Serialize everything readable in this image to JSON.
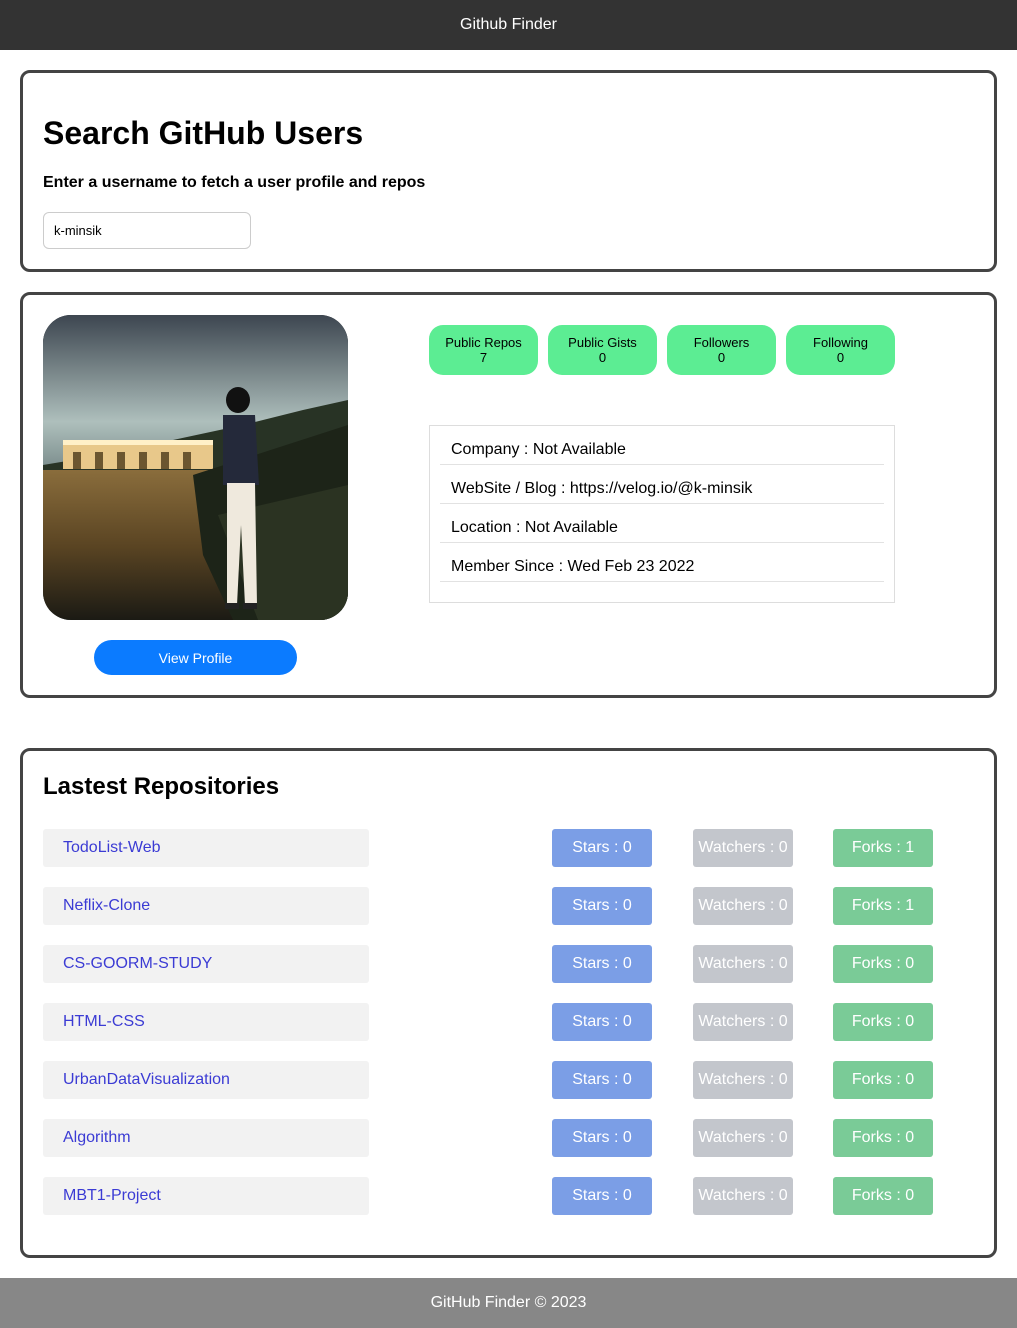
{
  "navbar": {
    "title": "Github Finder"
  },
  "search": {
    "title": "Search GitHub Users",
    "subtitle": "Enter a username to fetch a user profile and repos",
    "value": "k-minsik"
  },
  "profile": {
    "view_profile_label": "View Profile",
    "stats": [
      {
        "label": "Public Repos",
        "value": "7"
      },
      {
        "label": "Public Gists",
        "value": "0"
      },
      {
        "label": "Followers",
        "value": "0"
      },
      {
        "label": "Following",
        "value": "0"
      }
    ],
    "info": [
      "Company : Not Available",
      "WebSite / Blog : https://velog.io/@k-minsik",
      "Location : Not Available",
      "Member Since : Wed Feb 23 2022"
    ]
  },
  "repos": {
    "title": "Lastest Repositories",
    "items": [
      {
        "name": "TodoList-Web",
        "stars": "Stars : 0",
        "watchers": "Watchers : 0",
        "forks": "Forks : 1"
      },
      {
        "name": "Neflix-Clone",
        "stars": "Stars : 0",
        "watchers": "Watchers : 0",
        "forks": "Forks : 1"
      },
      {
        "name": "CS-GOORM-STUDY",
        "stars": "Stars : 0",
        "watchers": "Watchers : 0",
        "forks": "Forks : 0"
      },
      {
        "name": "HTML-CSS",
        "stars": "Stars : 0",
        "watchers": "Watchers : 0",
        "forks": "Forks : 0"
      },
      {
        "name": "UrbanDataVisualization",
        "stars": "Stars : 0",
        "watchers": "Watchers : 0",
        "forks": "Forks : 0"
      },
      {
        "name": "Algorithm",
        "stars": "Stars : 0",
        "watchers": "Watchers : 0",
        "forks": "Forks : 0"
      },
      {
        "name": "MBT1-Project",
        "stars": "Stars : 0",
        "watchers": "Watchers : 0",
        "forks": "Forks : 0"
      }
    ]
  },
  "footer": {
    "text": "GitHub Finder © 2023"
  },
  "colors": {
    "navbar_bg": "#333333",
    "stat_bg": "#5ced93",
    "button_bg": "#0b7bff",
    "stars_bg": "#7b9ee6",
    "watchers_bg": "#c3c6cc",
    "forks_bg": "#7acb97",
    "footer_bg": "#878787"
  }
}
